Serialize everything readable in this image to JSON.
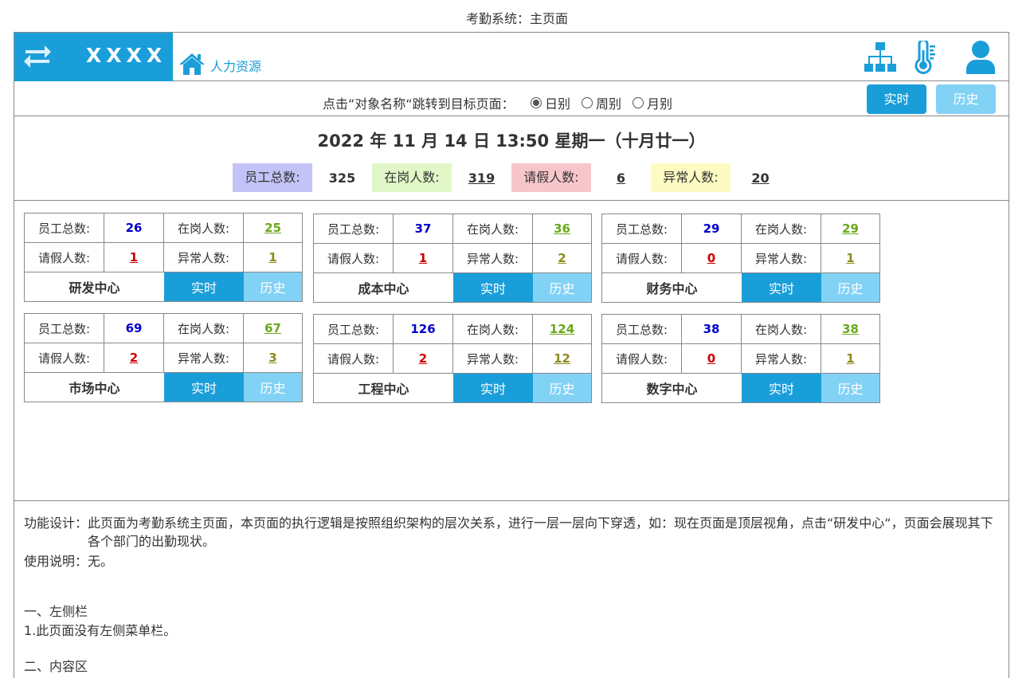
{
  "page_title": "考勤系统：主页面",
  "header": {
    "logo_text": "XXXX",
    "home_label": "人力资源",
    "icons": [
      "swap-icon",
      "home-icon",
      "org-chart-icon",
      "thermometer-icon",
      "user-icon"
    ]
  },
  "nav": {
    "hint": "点击“对象名称“跳转到目标页面：",
    "options": [
      {
        "label": "日别",
        "checked": true
      },
      {
        "label": "周别",
        "checked": false
      },
      {
        "label": "月别",
        "checked": false
      }
    ],
    "realtime_label": "实时",
    "history_label": "历史"
  },
  "summary": {
    "datetime": "2022 年 11 月 14 日 13:50  星期一（十月廿一）",
    "total_label": "员工总数:",
    "total_value": "325",
    "onduty_label": "在岗人数:",
    "onduty_value": "319",
    "leave_label": "请假人数:",
    "leave_value": "6",
    "abnormal_label": "异常人数:",
    "abnormal_value": "20"
  },
  "cards_labels": {
    "total": "员工总数:",
    "onduty": "在岗人数:",
    "leave": "请假人数:",
    "abnormal": "异常人数:",
    "realtime": "实时",
    "history": "历史"
  },
  "cards": [
    {
      "name": "研发中心",
      "total": "26",
      "onduty": "25",
      "leave": "1",
      "abnormal": "1"
    },
    {
      "name": "成本中心",
      "total": "37",
      "onduty": "36",
      "leave": "1",
      "abnormal": "2"
    },
    {
      "name": "财务中心",
      "total": "29",
      "onduty": "29",
      "leave": "0",
      "abnormal": "1"
    },
    {
      "name": "市场中心",
      "total": "69",
      "onduty": "67",
      "leave": "2",
      "abnormal": "3"
    },
    {
      "name": "工程中心",
      "total": "126",
      "onduty": "124",
      "leave": "2",
      "abnormal": "12"
    },
    {
      "name": "数字中心",
      "total": "38",
      "onduty": "38",
      "leave": "0",
      "abnormal": "1"
    }
  ],
  "notes": {
    "design_label": "功能设计：",
    "design_text": "此页面为考勤系统主页面，本页面的执行逻辑是按照组织架构的层次关系，进行一层一层向下穿透，如：现在页面是顶层视角，点击“研发中心“，页面会展现其下各个部门的出勤现状。",
    "usage": "使用说明：无。",
    "section1_title": "一、左侧栏",
    "section1_item": "1.此页面没有左侧菜单栏。",
    "section2_title": "二、内容区"
  },
  "colors": {
    "primary": "#1a9ed9",
    "light": "#82d2f5",
    "blue_value": "#0000cc",
    "green_value": "#6aa81c",
    "red_value": "#cc0000",
    "olive_value": "#8a8a1a"
  }
}
